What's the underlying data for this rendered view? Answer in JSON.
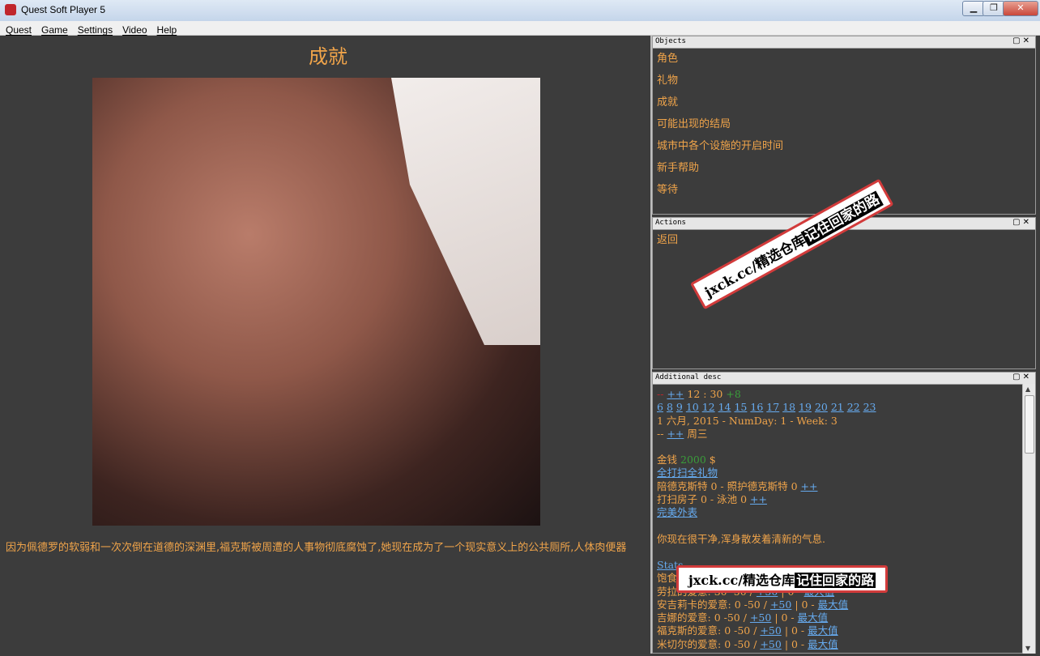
{
  "window": {
    "title": "Quest Soft Player 5",
    "minimize": "▁",
    "restore": "❐",
    "close": "✕"
  },
  "menu": [
    "Quest",
    "Game",
    "Settings",
    "Video",
    "Help"
  ],
  "main": {
    "title": "成就",
    "story": "因为佩德罗的软弱和一次次倒在道德的深渊里,福克斯被周遭的人事物彻底腐蚀了,她现在成为了一个现实意义上的公共厕所,人体肉便器"
  },
  "objects_panel": {
    "title": "Objects",
    "items": [
      "角色",
      "礼物",
      "成就",
      "可能出现的结局",
      "城市中各个设施的开启时间",
      "新手帮助",
      "等待"
    ]
  },
  "actions_panel": {
    "title": "Actions",
    "items": [
      "返回"
    ]
  },
  "desc_panel": {
    "title": "Additional desc",
    "time_prefix": "--",
    "time_link": "++",
    "time": "12 : 30",
    "time_extra": "+8",
    "hours": [
      "6",
      "8",
      "9",
      "10",
      "12",
      "14",
      "15",
      "16",
      "17",
      "18",
      "19",
      "20",
      "21",
      "22",
      "23"
    ],
    "date": "1 六月, 2015 - NumDay: 1 - Week: 3",
    "day_prefix": "--",
    "day_link": "++",
    "weekday": "周三",
    "money_label": "金钱",
    "money_value": "2000",
    "money_unit": "$",
    "cheat_links": [
      "全打扫",
      "全礼物"
    ],
    "line_dexter": "陪德克斯特 0 - 照护德克斯特 0",
    "line_dexter_link": "++",
    "line_clean": "打扫房子 0 - 泳池 0",
    "line_clean_link": "++",
    "perfect_link": "完美外表",
    "clean_status": "你现在很干净,浑身散发着清新的气息.",
    "stats_link": "Stats",
    "love_rows": [
      {
        "label": "饱食",
        "value": "",
        "plus": "",
        "rest": "",
        "max": ""
      },
      {
        "label": "劳拉的爱意:",
        "value": "30 -50 /",
        "plus": "+50",
        "rest": "| 0 -",
        "max": "最大值"
      },
      {
        "label": "安吉莉卡的爱意:",
        "value": "0 -50 /",
        "plus": "+50",
        "rest": "| 0 -",
        "max": "最大值"
      },
      {
        "label": "吉娜的爱意:",
        "value": "0 -50 /",
        "plus": "+50",
        "rest": "| 0 -",
        "max": "最大值"
      },
      {
        "label": "福克斯的爱意:",
        "value": "0 -50 /",
        "plus": "+50",
        "rest": "| 0 -",
        "max": "最大值"
      },
      {
        "label": "米切尔的爱意:",
        "value": "0 -50 /",
        "plus": "+50",
        "rest": "| 0 -",
        "max": "最大值"
      }
    ]
  },
  "watermark": {
    "site": "jxck.cc/精选仓库",
    "slogan": "记住回家的路"
  }
}
